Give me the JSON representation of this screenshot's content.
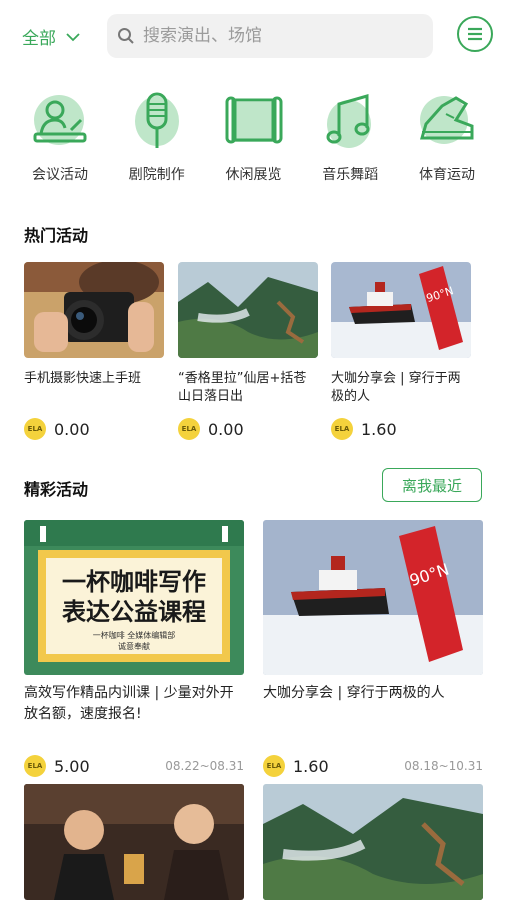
{
  "topbar": {
    "city_label": "全部",
    "search_placeholder": "搜索演出、场馆"
  },
  "categories": [
    {
      "label": "会议活动",
      "icon": "conference-icon"
    },
    {
      "label": "剧院制作",
      "icon": "microphone-icon"
    },
    {
      "label": "休闲展览",
      "icon": "scroll-icon"
    },
    {
      "label": "音乐舞蹈",
      "icon": "music-note-icon"
    },
    {
      "label": "体育运动",
      "icon": "sneaker-icon"
    }
  ],
  "hot": {
    "title": "热门活动",
    "items": [
      {
        "name": "手机摄影快速上手班",
        "currency": "ELA",
        "price": "0.00"
      },
      {
        "name": "“香格里拉”仙居+括苍山日落日出",
        "currency": "ELA",
        "price": "0.00"
      },
      {
        "name": "大咖分享会 | 穿行于两极的人",
        "currency": "ELA",
        "price": "1.60"
      }
    ]
  },
  "featured": {
    "title": "精彩活动",
    "nearby_label": "离我最近",
    "items": [
      {
        "poster_line1": "一杯咖啡写作",
        "poster_line2": "表达公益课程",
        "poster_sub1": "一杯咖啡 全媒体编辑部",
        "poster_sub2": "诚意奉献",
        "name": "高效写作精品内训课 | 少量对外开放名额，速度报名!",
        "currency": "ELA",
        "price": "5.00",
        "date": "08.22~08.31"
      },
      {
        "name": "大咖分享会 | 穿行于两极的人",
        "currency": "ELA",
        "price": "1.60",
        "date": "08.18~10.31"
      }
    ]
  },
  "colors": {
    "accent": "#3aa85a",
    "coin": "#f4d23c"
  }
}
